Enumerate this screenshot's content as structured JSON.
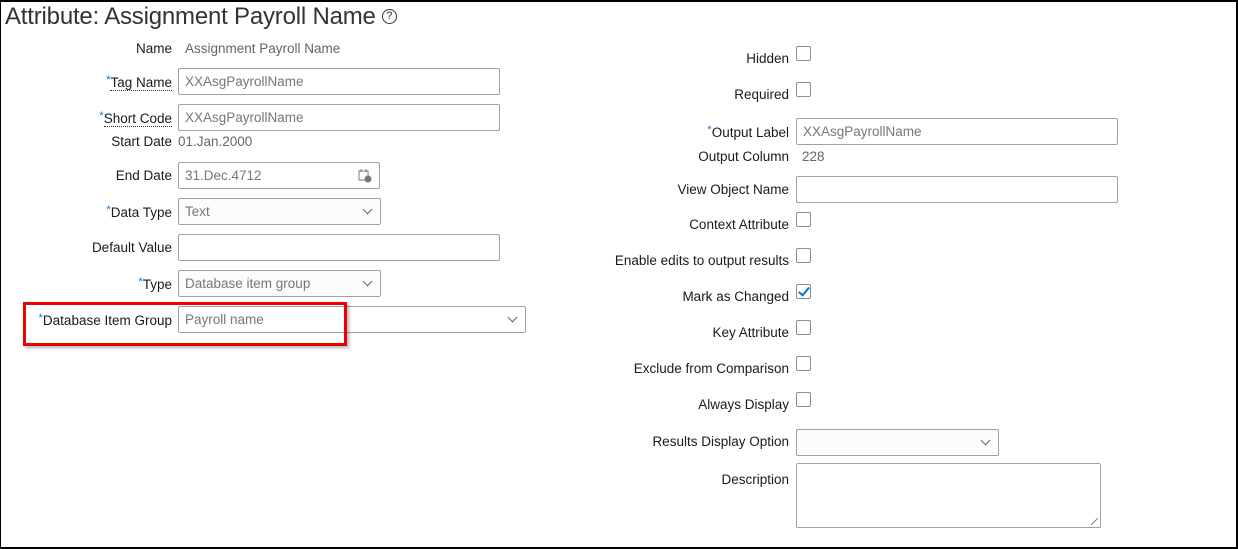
{
  "title": "Attribute: Assignment Payroll Name",
  "left": {
    "name": {
      "label": "Name",
      "value": "Assignment Payroll Name"
    },
    "tag_name": {
      "label": "Tag Name",
      "value": "XXAsgPayrollName"
    },
    "short_code": {
      "label": "Short Code",
      "value": "XXAsgPayrollName"
    },
    "start_date": {
      "label": "Start Date",
      "value": "01.Jan.2000"
    },
    "end_date": {
      "label": "End Date",
      "value": "31.Dec.4712"
    },
    "data_type": {
      "label": "Data Type",
      "value": "Text"
    },
    "default_value": {
      "label": "Default Value",
      "value": ""
    },
    "type": {
      "label": "Type",
      "value": "Database item group"
    },
    "db_item_group": {
      "label": "Database Item Group",
      "value": "Payroll name"
    }
  },
  "right": {
    "hidden": {
      "label": "Hidden",
      "checked": false
    },
    "required": {
      "label": "Required",
      "checked": false
    },
    "output_label": {
      "label": "Output Label",
      "value": "XXAsgPayrollName"
    },
    "output_column": {
      "label": "Output Column",
      "value": "228"
    },
    "view_object_name": {
      "label": "View Object Name",
      "value": ""
    },
    "context_attribute": {
      "label": "Context Attribute",
      "checked": false
    },
    "enable_edits": {
      "label": "Enable edits to output results",
      "checked": false
    },
    "mark_as_changed": {
      "label": "Mark as Changed",
      "checked": true
    },
    "key_attribute": {
      "label": "Key Attribute",
      "checked": false
    },
    "exclude": {
      "label": "Exclude from Comparison",
      "checked": false
    },
    "always_display": {
      "label": "Always Display",
      "checked": false
    },
    "results_display_option": {
      "label": "Results Display Option",
      "value": ""
    },
    "description": {
      "label": "Description",
      "value": ""
    }
  },
  "required_marker": "*",
  "colors": {
    "required": "#0572ce",
    "highlight": "#e00000"
  }
}
